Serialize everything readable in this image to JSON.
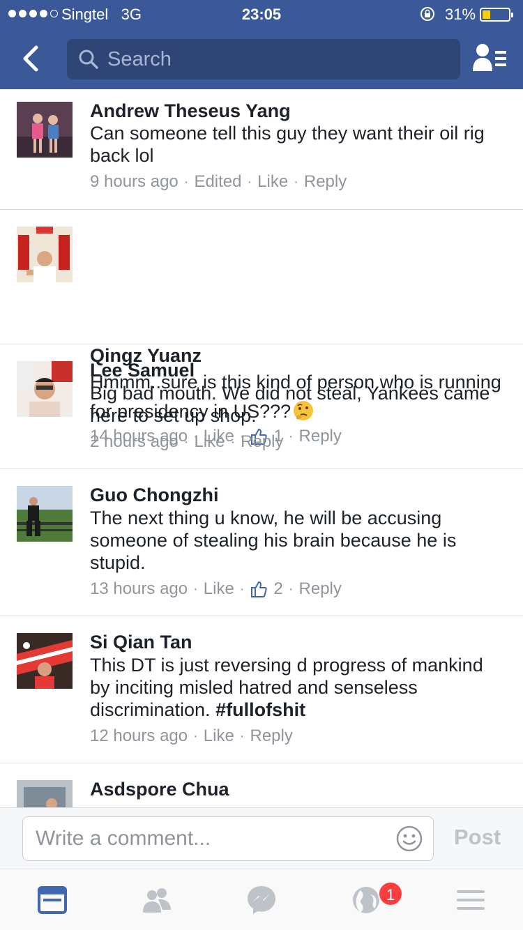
{
  "status_bar": {
    "carrier": "Singtel",
    "network": "3G",
    "time": "23:05",
    "battery_percent": "31%",
    "battery_level": 0.31
  },
  "nav": {
    "search_placeholder": "Search"
  },
  "comments": [
    {
      "author": "Andrew Theseus Yang",
      "text": "Can someone tell this guy they want their oil rig back lol",
      "time": "9 hours ago",
      "edited": "Edited",
      "like": "Like",
      "reply": "Reply"
    },
    {
      "author": "Qingz Yuanz",
      "text": "Hmmm..sure is this kind of person who is running for presidency in US???",
      "emoji": "thinking-face",
      "time": "14 hours ago",
      "like": "Like",
      "likes_count": "1",
      "reply": "Reply"
    },
    {
      "author": "Lee Samuel",
      "text": "Big bad mouth. We did not steal, Yankees came here to set up shop.",
      "time": "2 hours ago",
      "like": "Like",
      "reply": "Reply"
    },
    {
      "author": "Guo Chongzhi",
      "text": "The next thing u know, he will be accusing someone of stealing his brain because he is stupid.",
      "time": "13 hours ago",
      "like": "Like",
      "likes_count": "2",
      "reply": "Reply"
    },
    {
      "author": "Si Qian Tan",
      "text": "This DT is just reversing d progress of mankind by inciting misled hatred and senseless discrimination.",
      "hashtag": "#fullofshit",
      "time": "12 hours ago",
      "like": "Like",
      "reply": "Reply"
    },
    {
      "author": "Asdspore Chua"
    }
  ],
  "composer": {
    "placeholder": "Write a comment...",
    "post_label": "Post"
  },
  "tab_bar": {
    "notifications_badge": "1"
  },
  "colors": {
    "brand": "#3b5998",
    "link_blue": "#4267b2",
    "meta_gray": "#90949c",
    "badge_red": "#fa3e3e"
  }
}
